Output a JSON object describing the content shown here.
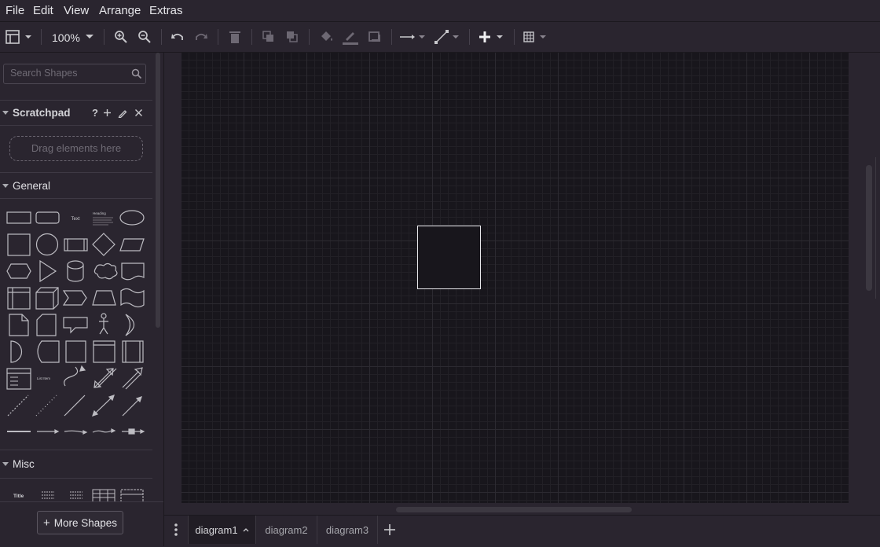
{
  "menu": [
    "File",
    "Edit",
    "View",
    "Arrange",
    "Extras"
  ],
  "toolbar": {
    "zoom": "100%",
    "icons": [
      "format-panel-icon",
      "zoom-in-icon",
      "zoom-out-icon",
      "undo-icon",
      "redo-icon",
      "delete-icon",
      "to-front-icon",
      "to-back-icon",
      "fill-color-icon",
      "line-color-icon",
      "shadow-icon",
      "connection-icon",
      "waypoints-icon",
      "insert-icon",
      "table-icon"
    ]
  },
  "sidebar": {
    "search_placeholder": "Search Shapes",
    "scratchpad": {
      "title": "Scratchpad",
      "help": "?",
      "drop_text": "Drag elements here"
    },
    "general": {
      "title": "General"
    },
    "misc": {
      "title": "Misc"
    },
    "more_shapes": "More Shapes",
    "shape_labels": {
      "text": "Text",
      "heading": "Heading",
      "list_item": "List Item",
      "title": "Title"
    }
  },
  "pages": {
    "tabs": [
      "diagram1",
      "diagram2",
      "diagram3"
    ],
    "active": "diagram1"
  },
  "colors": {
    "canvas": "#18161c",
    "chrome": "#2a252f",
    "shape_stroke": "#e8e8ec"
  }
}
